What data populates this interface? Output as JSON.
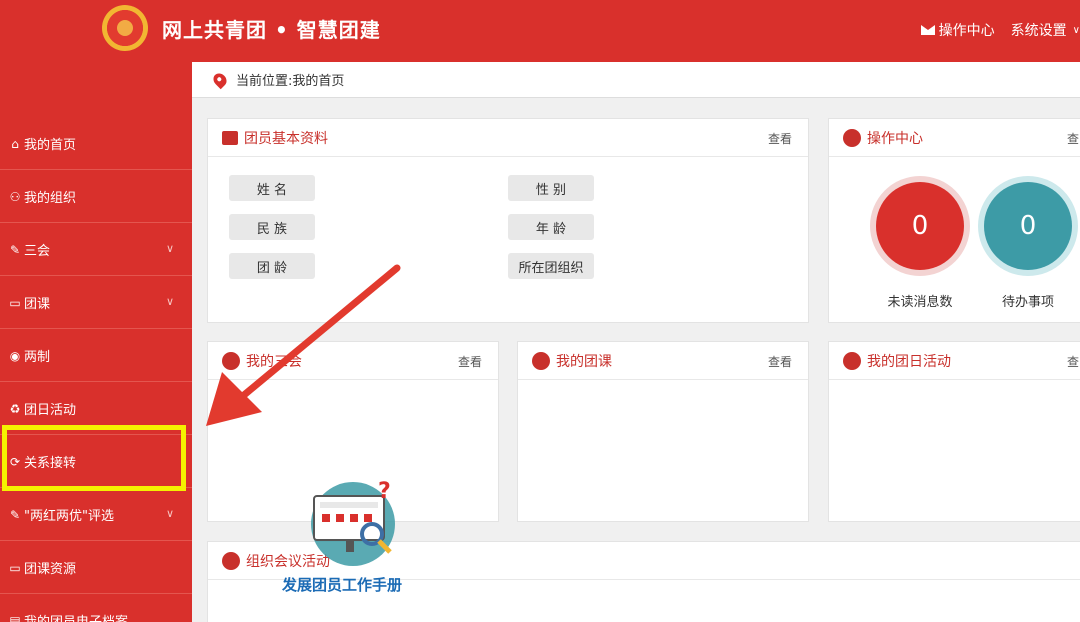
{
  "header": {
    "title": "网上共青团 • 智慧团建",
    "ops_center": "操作中心",
    "settings": "系统设置"
  },
  "breadcrumb": "当前位置:我的首页",
  "sidebar": {
    "items": [
      {
        "label": "我的首页",
        "icon": "home-icon",
        "glyph": "⌂"
      },
      {
        "label": "我的组织",
        "icon": "users-icon",
        "glyph": "👥"
      },
      {
        "label": "三会",
        "icon": "edit-icon",
        "glyph": "✎",
        "chevron": true
      },
      {
        "label": "团课",
        "icon": "folder-icon",
        "glyph": "▬",
        "chevron": true
      },
      {
        "label": "两制",
        "icon": "target-icon",
        "glyph": "◉"
      },
      {
        "label": "团日活动",
        "icon": "recycle-icon",
        "glyph": "♻"
      },
      {
        "label": "关系接转",
        "icon": "refresh-icon",
        "glyph": "⟳"
      },
      {
        "label": "\"两红两优\"评选",
        "icon": "edit-icon",
        "glyph": "✎",
        "chevron": true
      },
      {
        "label": "团课资源",
        "icon": "folder-icon",
        "glyph": "▬"
      },
      {
        "label": "我的团员电子档案",
        "icon": "document-icon",
        "glyph": "▤"
      }
    ]
  },
  "profile": {
    "title": "团员基本资料",
    "more": "查看",
    "fields": [
      "姓 名",
      "性 别",
      "民 族",
      "年 龄",
      "团 龄",
      "所在团组织"
    ]
  },
  "ops": {
    "title": "操作中心",
    "more": "查",
    "unread_count": "0",
    "unread_label": "未读消息数",
    "todo_count": "0",
    "todo_label": "待办事项"
  },
  "panels": {
    "meetings": {
      "title": "我的三会",
      "more": "查看"
    },
    "courses": {
      "title": "我的团课",
      "more": "查看"
    },
    "activities": {
      "title": "我的团日活动",
      "more": "查"
    },
    "org_meetings": {
      "title": "组织会议活动"
    }
  },
  "watermark": {
    "text": "发展团员工作手册"
  },
  "colors": {
    "primary": "#d9302c",
    "highlight": "#f5f100",
    "teal": "#3d9ba6",
    "watermark": "#1b6bb5"
  }
}
